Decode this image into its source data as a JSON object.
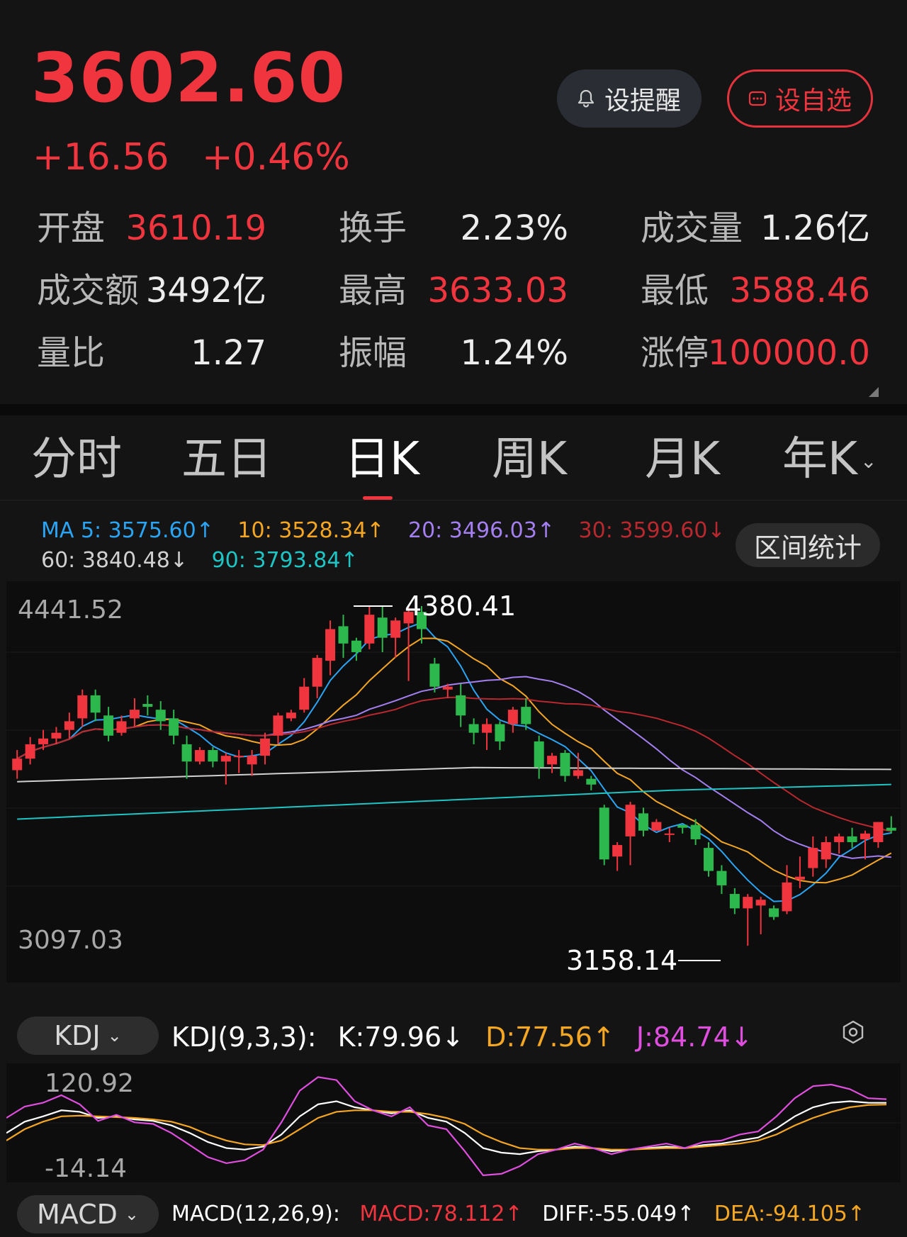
{
  "quote": {
    "price": "3602.60",
    "change": "+16.56",
    "change_pct": "+0.46%",
    "color_up": "#f0353f",
    "color_down": "#2db84d"
  },
  "buttons": {
    "alert": "设提醒",
    "alert_icon": "bell-icon",
    "favorite": "设自选",
    "favorite_icon": "chat-dots-icon"
  },
  "stats": [
    {
      "label": "开盘",
      "value": "3610.19",
      "color": "red"
    },
    {
      "label": "换手",
      "value": "2.23%",
      "color": "white"
    },
    {
      "label": "成交量",
      "value": "1.26亿",
      "color": "white"
    },
    {
      "label": "成交额",
      "value": "3492亿",
      "color": "white"
    },
    {
      "label": "最高",
      "value": "3633.03",
      "color": "red"
    },
    {
      "label": "最低",
      "value": "3588.46",
      "color": "red"
    },
    {
      "label": "量比",
      "value": "1.27",
      "color": "white"
    },
    {
      "label": "振幅",
      "value": "1.24%",
      "color": "white"
    },
    {
      "label": "涨停",
      "value": "100000.0",
      "color": "red"
    }
  ],
  "tabs": [
    {
      "label": "分时"
    },
    {
      "label": "五日"
    },
    {
      "label": "日K"
    },
    {
      "label": "周K"
    },
    {
      "label": "月K"
    },
    {
      "label": "年K"
    }
  ],
  "active_tab": "日K",
  "tab_more_icon": "chevron-down-icon",
  "ma": {
    "ma5": {
      "label": "MA 5: 3575.60↑",
      "color": "#2aa4f5"
    },
    "ma10": {
      "label": "10: 3528.34↑",
      "color": "#f5a623"
    },
    "ma20": {
      "label": "20: 3496.03↑",
      "color": "#a37ff0"
    },
    "ma30": {
      "label": "30: 3599.60↓",
      "color": "#b8282e"
    },
    "ma60": {
      "label": "60: 3840.48↓",
      "color": "#d0d0d0"
    },
    "ma90": {
      "label": "90: 3793.84↑",
      "color": "#1fc4c4"
    }
  },
  "interval_stats_button": "区间统计",
  "kline": {
    "axis_high": "4441.52",
    "axis_low": "3097.03",
    "peak_label": "4380.41",
    "trough_label": "3158.14"
  },
  "chart_data": [
    {
      "type": "candlestick",
      "title": "",
      "ylim": [
        3097.03,
        4441.52
      ],
      "annotations": [
        "4380.41",
        "3158.14"
      ],
      "series_names": [
        "MA 5",
        "10",
        "20",
        "30",
        "60",
        "90"
      ],
      "candles": [
        [
          3810,
          3850,
          3780,
          3880
        ],
        [
          3850,
          3900,
          3830,
          3925
        ],
        [
          3900,
          3920,
          3880,
          3950
        ],
        [
          3920,
          3940,
          3900,
          3960
        ],
        [
          3950,
          3980,
          3920,
          4010
        ],
        [
          3990,
          4070,
          3960,
          4090
        ],
        [
          4070,
          4010,
          3980,
          4090
        ],
        [
          4000,
          3930,
          3910,
          4030
        ],
        [
          3940,
          3980,
          3930,
          4000
        ],
        [
          3990,
          4020,
          3960,
          4060
        ],
        [
          4040,
          4030,
          4000,
          4070
        ],
        [
          4020,
          3980,
          3950,
          4050
        ],
        [
          3990,
          3930,
          3900,
          4020
        ],
        [
          3900,
          3840,
          3780,
          3930
        ],
        [
          3840,
          3880,
          3830,
          3890
        ],
        [
          3880,
          3840,
          3820,
          3890
        ],
        [
          3840,
          3860,
          3760,
          3870
        ],
        [
          3860,
          3860,
          3800,
          3880
        ],
        [
          3830,
          3860,
          3790,
          3880
        ],
        [
          3860,
          3920,
          3830,
          3940
        ],
        [
          3930,
          4000,
          3900,
          4010
        ],
        [
          3990,
          4010,
          3980,
          4020
        ],
        [
          4020,
          4100,
          4010,
          4130
        ],
        [
          4100,
          4200,
          4060,
          4210
        ],
        [
          4190,
          4300,
          4140,
          4330
        ],
        [
          4310,
          4250,
          4200,
          4350
        ],
        [
          4260,
          4220,
          4190,
          4270
        ],
        [
          4250,
          4350,
          4230,
          4380
        ],
        [
          4340,
          4270,
          4220,
          4380
        ],
        [
          4270,
          4330,
          4200,
          4340
        ],
        [
          4320,
          4360,
          4120,
          4380
        ],
        [
          4360,
          4300,
          4250,
          4380
        ],
        [
          4180,
          4100,
          4080,
          4200
        ],
        [
          4090,
          4100,
          4060,
          4110
        ],
        [
          4070,
          4000,
          3960,
          4110
        ],
        [
          3970,
          3940,
          3900,
          3990
        ],
        [
          3940,
          3970,
          3880,
          3990
        ],
        [
          3970,
          3910,
          3880,
          3980
        ],
        [
          3970,
          4020,
          3940,
          4030
        ],
        [
          4030,
          3970,
          3950,
          4060
        ],
        [
          3910,
          3820,
          3780,
          3930
        ],
        [
          3830,
          3860,
          3800,
          3870
        ],
        [
          3870,
          3790,
          3770,
          3880
        ],
        [
          3790,
          3810,
          3780,
          3870
        ],
        [
          3780,
          3760,
          3740,
          3790
        ],
        [
          3680,
          3500,
          3480,
          3690
        ],
        [
          3510,
          3550,
          3460,
          3560
        ],
        [
          3580,
          3690,
          3480,
          3700
        ],
        [
          3660,
          3600,
          3580,
          3680
        ],
        [
          3600,
          3630,
          3600,
          3640
        ],
        [
          3590,
          3590,
          3560,
          3610
        ],
        [
          3620,
          3610,
          3590,
          3620
        ],
        [
          3620,
          3570,
          3550,
          3640
        ],
        [
          3540,
          3460,
          3440,
          3560
        ],
        [
          3460,
          3410,
          3380,
          3480
        ],
        [
          3380,
          3330,
          3310,
          3400
        ],
        [
          3330,
          3370,
          3200,
          3380
        ],
        [
          3340,
          3360,
          3240,
          3370
        ],
        [
          3330,
          3300,
          3290,
          3340
        ],
        [
          3320,
          3420,
          3310,
          3480
        ],
        [
          3430,
          3440,
          3400,
          3510
        ],
        [
          3470,
          3540,
          3440,
          3580
        ],
        [
          3500,
          3560,
          3470,
          3580
        ],
        [
          3560,
          3580,
          3520,
          3590
        ],
        [
          3580,
          3560,
          3540,
          3610
        ],
        [
          3570,
          3590,
          3500,
          3600
        ],
        [
          3560,
          3630,
          3540,
          3630
        ],
        [
          3610,
          3600,
          3590,
          3650
        ]
      ]
    },
    {
      "type": "line",
      "title": "KDJ(9,3,3)",
      "ylim": [
        -14.14,
        120.92
      ],
      "series": [
        {
          "name": "K:79.96↓",
          "values": [
            40,
            55,
            62,
            70,
            68,
            60,
            62,
            58,
            56,
            50,
            40,
            28,
            20,
            18,
            22,
            38,
            62,
            78,
            82,
            74,
            70,
            66,
            70,
            60,
            55,
            40,
            20,
            14,
            12,
            16,
            18,
            22,
            20,
            16,
            18,
            20,
            22,
            20,
            24,
            26,
            30,
            34,
            46,
            62,
            74,
            80,
            82,
            80,
            79.96
          ]
        },
        {
          "name": "D:77.56↑",
          "values": [
            30,
            45,
            55,
            62,
            63,
            62,
            61,
            60,
            58,
            55,
            48,
            38,
            30,
            25,
            24,
            30,
            45,
            60,
            68,
            70,
            70,
            68,
            68,
            65,
            60,
            52,
            38,
            28,
            20,
            18,
            18,
            20,
            20,
            18,
            18,
            19,
            20,
            20,
            22,
            24,
            26,
            30,
            38,
            50,
            60,
            68,
            74,
            77,
            77.56
          ]
        },
        {
          "name": "J:84.74↓",
          "values": [
            60,
            75,
            80,
            90,
            78,
            56,
            64,
            54,
            52,
            40,
            24,
            8,
            0,
            4,
            18,
            54,
            96,
            114,
            110,
            82,
            70,
            62,
            74,
            50,
            45,
            16,
            -16,
            -14,
            -4,
            12,
            18,
            26,
            20,
            12,
            18,
            22,
            26,
            20,
            28,
            30,
            38,
            42,
            62,
            86,
            102,
            104,
            98,
            86,
            84.74
          ]
        }
      ]
    }
  ],
  "kdj": {
    "selector": "KDJ",
    "selector_icon": "chevron-down-icon",
    "params": "KDJ(9,3,3):",
    "k": "K:79.96↓",
    "d": "D:77.56↑",
    "j": "J:84.74↓",
    "k_color": "#ffffff",
    "d_color": "#f5a623",
    "j_color": "#e04ee0",
    "axis_high": "120.92",
    "axis_low": "-14.14",
    "settings_icon": "hexagon-settings-icon"
  },
  "macd": {
    "selector": "MACD",
    "selector_icon": "chevron-down-icon",
    "params": "MACD(12,26,9):",
    "macd": "MACD:78.112↑",
    "diff": "DIFF:-55.049↑",
    "dea": "DEA:-94.105↑",
    "macd_color": "#f0353f",
    "diff_color": "#ffffff",
    "dea_color": "#f5a623"
  }
}
